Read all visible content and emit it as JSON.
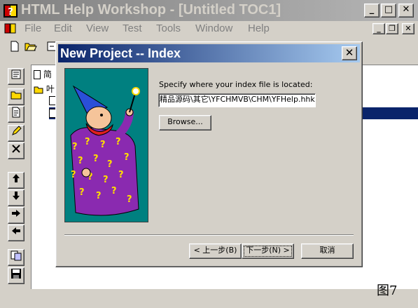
{
  "window": {
    "title": "HTML Help Workshop - [Untitled TOC1]",
    "minimize_glyph": "_",
    "maximize_glyph": "□",
    "close_glyph": "✕",
    "mdi_restore_glyph": "❐"
  },
  "menubar": {
    "items": [
      {
        "label": "File"
      },
      {
        "label": "Edit"
      },
      {
        "label": "View"
      },
      {
        "label": "Test"
      },
      {
        "label": "Tools"
      },
      {
        "label": "Window"
      },
      {
        "label": "Help"
      }
    ]
  },
  "toolbar": {
    "icons": [
      "new-file-icon",
      "open-folder-icon",
      "compile-icon"
    ]
  },
  "side_toolbar": {
    "icons": [
      "table-of-contents-properties-icon",
      "insert-heading-icon",
      "insert-page-icon",
      "edit-pencil-icon",
      "delete-x-icon",
      "move-up-icon",
      "move-down-icon",
      "move-right-icon",
      "move-left-icon",
      "view-html-source-icon",
      "save-file-icon"
    ]
  },
  "toc_tree": {
    "items": [
      {
        "label": "简"
      },
      {
        "label": "叶"
      },
      {
        "label": ""
      },
      {
        "label": ""
      }
    ]
  },
  "dialog": {
    "title": "New Project -- Index",
    "instruction": "Specify where your index file is located:",
    "path_value": "精品源码\\其它\\YFCHMVB\\CHM\\YFHelp.hhk",
    "browse_label": "Browse...",
    "back_label": "< 上一步(B)",
    "next_label": "下一步(N) >",
    "cancel_label": "取消"
  },
  "figure_label": "图7",
  "colors": {
    "face": "#d4d0c8",
    "inactive_title": "#808080",
    "active_title": "#0a246a",
    "wizard_bg": "#008080",
    "selection": "#0a246a"
  }
}
